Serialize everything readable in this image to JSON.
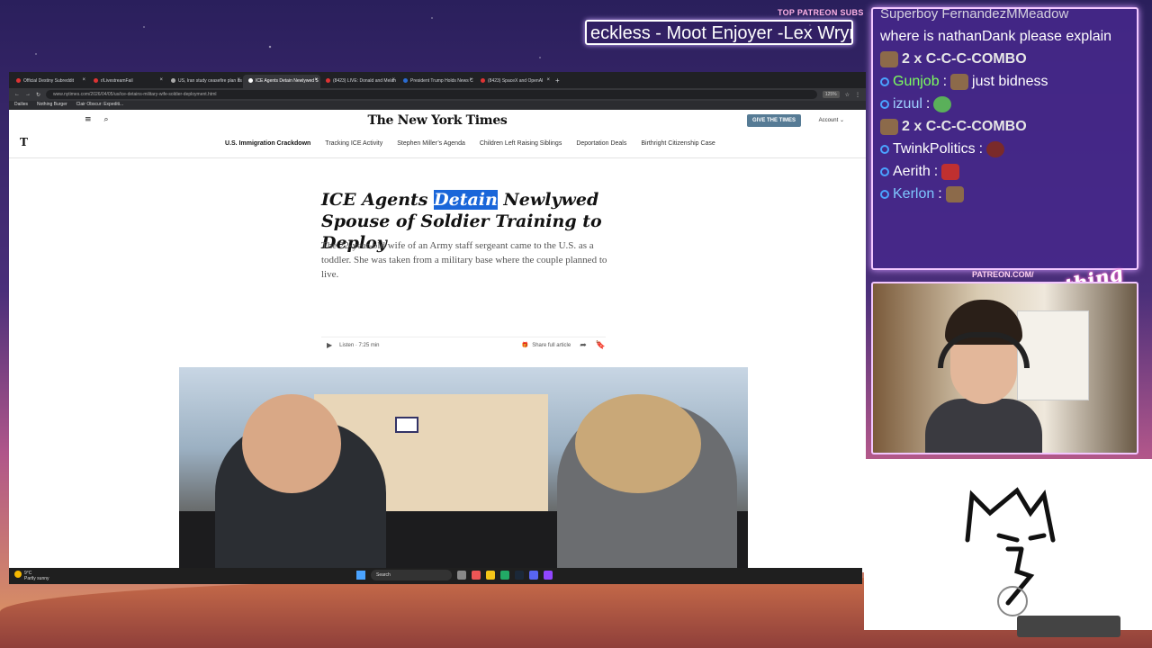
{
  "overlay": {
    "top_subs_label": "TOP PATREON SUBS",
    "ticker": "eckless - Moot Enjoyer -Lex Wryn",
    "patreon_label": "PATREON.COM/",
    "brand_script": "Anything Else"
  },
  "chat": {
    "top_line": "Superboy FernandezMMeadow",
    "line1": "where is nathanDank please explain",
    "combo1": "2 x C-C-C-COMBO",
    "gunjob_name": "Gunjob",
    "gunjob_msg": "just bidness",
    "izuul_name": "izuul",
    "combo2": "2 x C-C-C-COMBO",
    "twink_name": "TwinkPolitics",
    "aerith_name": "Aerith",
    "kerlon_name": "Kerlon"
  },
  "browser": {
    "tabs": [
      "Official Destiny Subreddit",
      "r/LivestreamFail",
      "US, Iran study ceasefire plan as",
      "ICE Agents Detain Newlywed S",
      "(8423) LIVE: Donald and Melan",
      "President Trump Holds News C",
      "(8423) SpaceX and OpenAI",
      "+"
    ],
    "url": "www.nytimes.com/2026/04/05/us/ice-detains-military-wife-soldier-deployment.html",
    "zoom": "125%",
    "bookmarks": [
      "Dailies",
      "Nothing Burger",
      "Clair Obscur: Expediti..."
    ]
  },
  "nyt": {
    "masthead": "The New York Times",
    "give_button": "GIVE THE TIMES",
    "account": "Account",
    "t_logo": "T",
    "nav": [
      "U.S. Immigration Crackdown",
      "Tracking ICE Activity",
      "Stephen Miller’s Agenda",
      "Children Left Raising Siblings",
      "Deportation Deals",
      "Birthright Citizenship Case"
    ],
    "headline_pre": "ICE Agents ",
    "headline_sel": "Detain",
    "headline_post": " Newlywed Spouse of Soldier Training to Deploy",
    "dek": "The 22-year-old wife of an Army staff sergeant came to the U.S. as a toddler. She was taken from a military base where the couple planned to live.",
    "listen": "Listen · 7:25 min",
    "share": "Share full article"
  },
  "taskbar": {
    "temp": "9°C",
    "weather": "Partly sunny",
    "search": "Search"
  }
}
